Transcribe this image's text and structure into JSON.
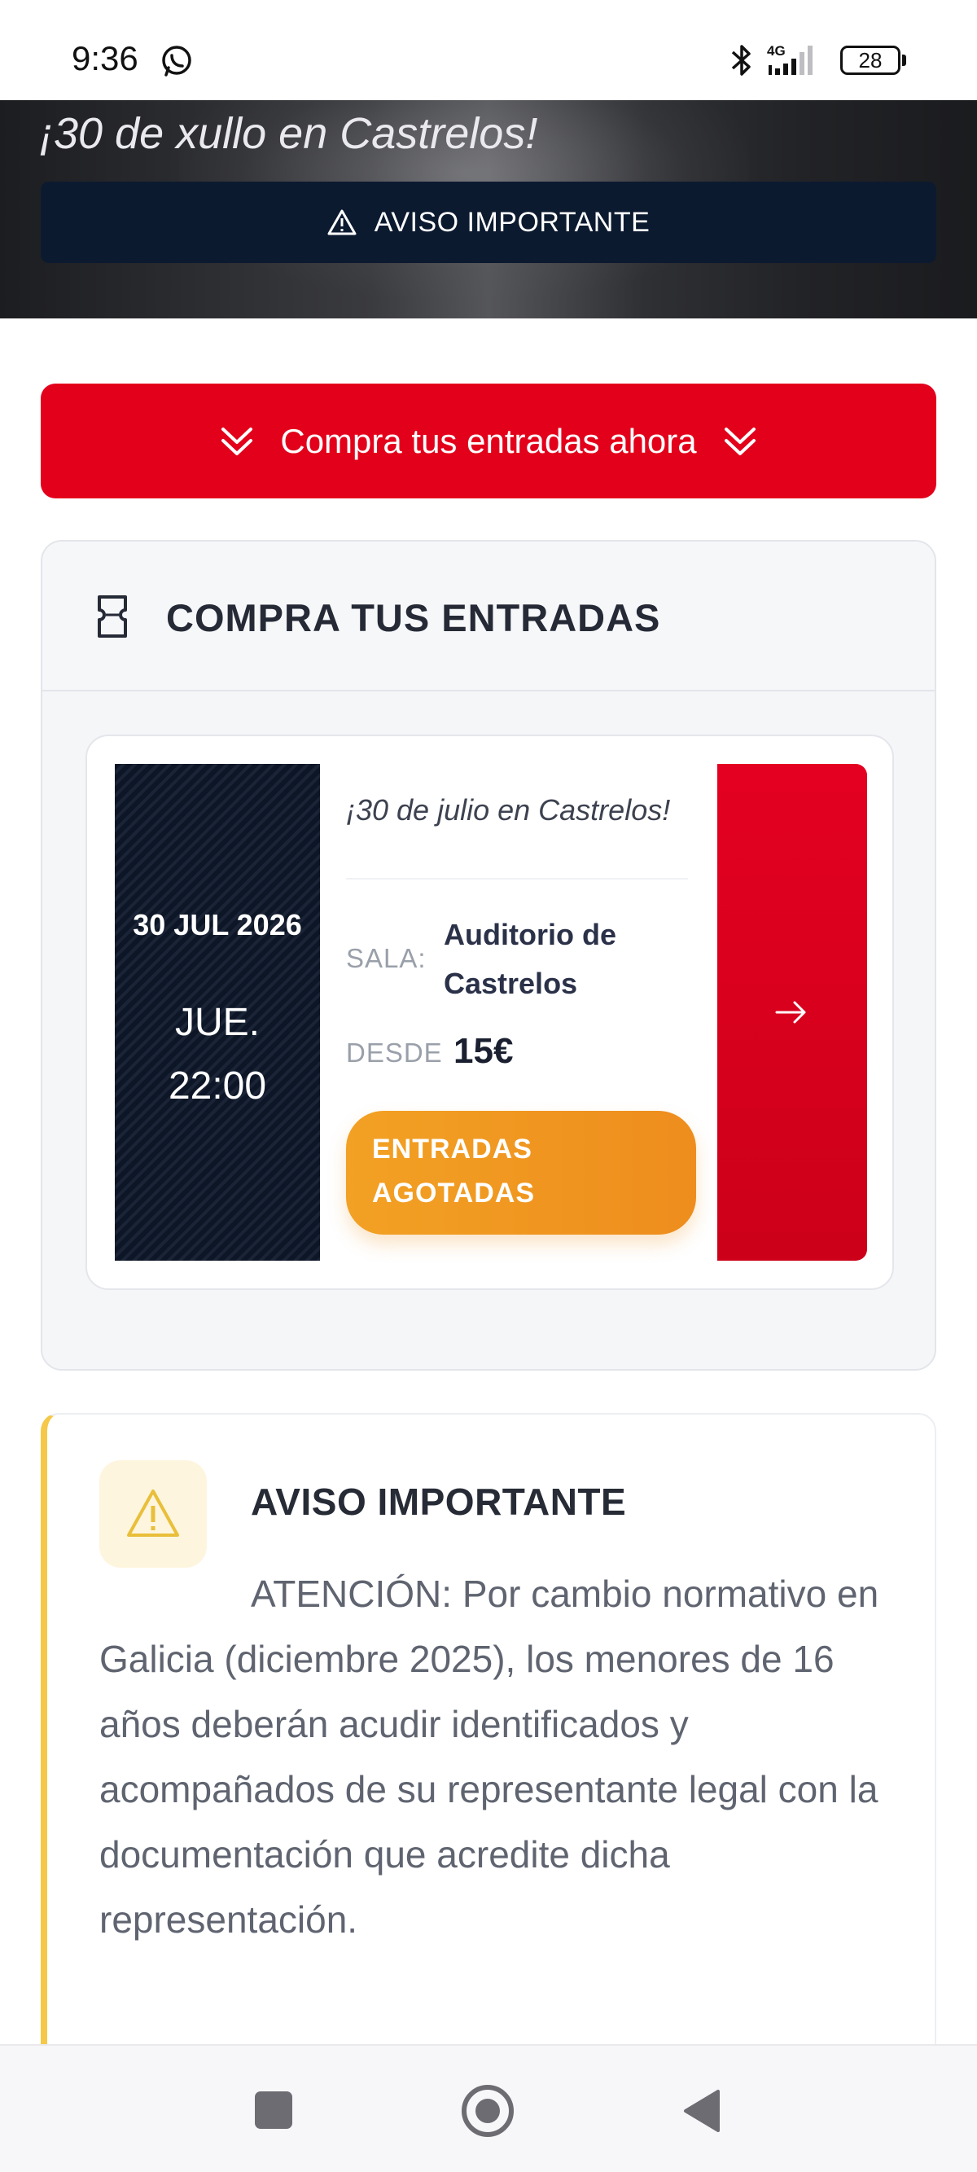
{
  "status_bar": {
    "time": "9:36",
    "network": "4G",
    "battery": "28"
  },
  "hero": {
    "subtitle": "¡30 de xullo en Castrelos!",
    "notice_label": "AVISO IMPORTANTE"
  },
  "buy_now": {
    "label": "Compra tus entradas ahora"
  },
  "tickets": {
    "title": "COMPRA TUS ENTRADAS",
    "event": {
      "date": "30 JUL 2026",
      "weekday": "JUE.",
      "time": "22:00",
      "subtitle": "¡30 de julio en Castrelos!",
      "venue_label": "SALA:",
      "venue": "Auditorio de Castrelos",
      "price_label": "DESDE",
      "price": "15€",
      "status_button": "ENTRADAS AGOTADAS"
    }
  },
  "notice": {
    "title": "AVISO IMPORTANTE",
    "body": "ATENCIÓN: Por cambio normativo en Galicia (diciembre 2025), los menores de 16 años deberán acudir identificados y acompañados de su representante legal con la documentación que acredite dicha representación."
  },
  "colors": {
    "brand_red": "#e3001b",
    "navy": "#0c1a30",
    "sold_out_orange": "#ee8d1d",
    "warning_yellow": "#f5c84a"
  },
  "icons": {
    "banner": "warning-triangle",
    "buy_now": "double-chevron-down",
    "section": "ticket",
    "event_go": "arrow-right",
    "notice": "warning-triangle"
  }
}
